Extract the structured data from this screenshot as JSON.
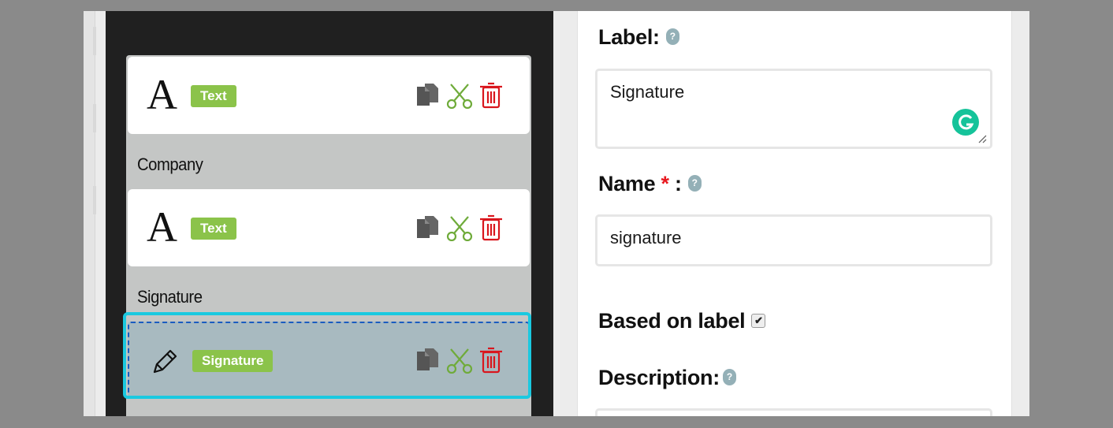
{
  "field_list": {
    "rows": [
      {
        "type_glyph": "A",
        "badge": "Text",
        "badge_color": "#8bc34a"
      },
      {
        "type_glyph": "A",
        "badge": "Text",
        "badge_color": "#8bc34a"
      },
      {
        "type_glyph": "pencil-icon",
        "badge": "Signature",
        "badge_color": "#8bc34a"
      }
    ],
    "section_labels": [
      "Company",
      "Signature"
    ],
    "actions": {
      "copy_icon": "copy-icon",
      "cut_icon": "scissors-icon",
      "delete_icon": "trash-icon"
    },
    "selected_outline_color": "#1ac9e0"
  },
  "properties": {
    "label_heading": "Label:",
    "label_value": "Signature",
    "name_heading": "Name",
    "name_required": "*",
    "name_colon": ":",
    "name_value": "signature",
    "based_on_label": "Based on label",
    "based_on_label_checked": true,
    "description_heading": "Description:",
    "help_glyph": "?"
  }
}
